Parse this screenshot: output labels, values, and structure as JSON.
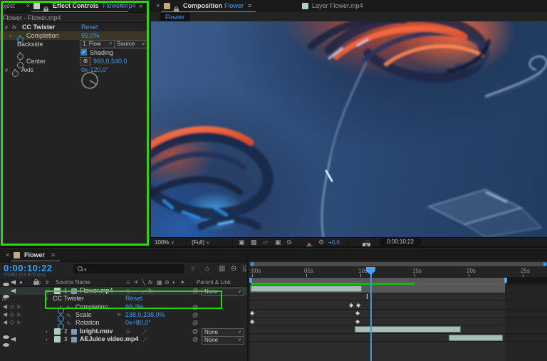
{
  "colors": {
    "accent_blue": "#3f9bf0",
    "annotation_green": "#2fd40f",
    "render_bar_green": "#17b517",
    "layer_bar": "#a7beb7",
    "selected_row": "#545a58"
  },
  "icons": {
    "close": "×",
    "menu": "≡",
    "overflow": "»",
    "chevron_down": "∨",
    "chevron_right": "›",
    "kf_prev": "◀",
    "kf_next": "▶",
    "kf_add": "◇",
    "keyframe": "◆",
    "crosshair": "⊕",
    "check": "✓",
    "link": "∞",
    "pickwhip": "@",
    "fx": "fx",
    "shy": "☺",
    "quality": "╲",
    "frame_blend": "▦",
    "motion_blur": "⊘",
    "adjustment": "◐",
    "cube": "✦",
    "solo": "●",
    "collapse": "✳",
    "graph": "∿",
    "label_tag": "⬖",
    "search_caret": "▾",
    "flowchart": "⑂",
    "draft3d": "⌂",
    "blend_frames": "▥",
    "blur_layers": "⊜",
    "graph_editor": "◱",
    "gear": "⚙"
  },
  "effect_controls": {
    "tab_ghost": "oject",
    "tab_title": "Effect Controls",
    "tab_file": "Flower.mp4",
    "header": "Flower - Flower.mp4",
    "effect_name": "CC Twister",
    "reset_label": "Reset",
    "completion_label": "Completion",
    "completion_value": "99,0%",
    "backside_label": "Backside",
    "backside_dd1": "1. Flow",
    "backside_dd2": "Source",
    "shading_label": "Shading",
    "center_label": "Center",
    "center_value": "960,0,540,0",
    "axis_label": "Axis",
    "axis_value": "0x-120,0°"
  },
  "viewer": {
    "tab_title": "Composition",
    "tab_file": "Flower",
    "tab2_title": "Layer Flower.mp4",
    "breadcrumb": "Flower",
    "zoom": "100%",
    "resolution": "(Full)",
    "exposure": "+0,0",
    "timecode": "0:00:10:22"
  },
  "timeline": {
    "tab": "Flower",
    "timecode": "0:00:10:22",
    "frames_info": "00262 (23.976 fps)",
    "col_number": "#",
    "col_source": "Source Name",
    "col_parent": "Parent & Link",
    "effect_group": "CC Twister",
    "reset_label": "Reset",
    "layers": [
      {
        "num": "1",
        "name": "Flower.mp4",
        "parent": "None"
      },
      {
        "num": "2",
        "name": "bright.mov",
        "parent": "None"
      },
      {
        "num": "3",
        "name": "AEJuice video.mp4",
        "parent": "None"
      }
    ],
    "properties": [
      {
        "name": "Completion",
        "value": "99,0%"
      },
      {
        "name": "Scale",
        "value": "238,0,238,0%"
      },
      {
        "name": "Rotation",
        "value": "0x+80,0°"
      }
    ],
    "ruler": [
      ":00s",
      "05s",
      "10s",
      "15s",
      "20s",
      "25s"
    ]
  }
}
